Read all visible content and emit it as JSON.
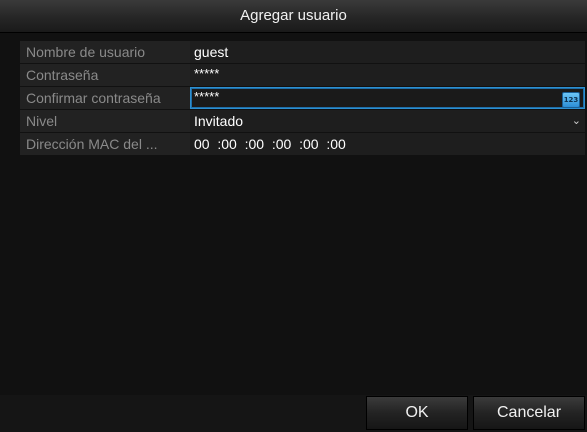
{
  "dialog": {
    "title": "Agregar usuario"
  },
  "form": {
    "username": {
      "label": "Nombre de usuario",
      "value": "guest"
    },
    "password": {
      "label": "Contraseña",
      "value": "*****"
    },
    "confirm_password": {
      "label": "Confirmar contraseña",
      "value": "*****",
      "keyboard_icon_text": "123"
    },
    "level": {
      "label": "Nivel",
      "value": "Invitado"
    },
    "mac": {
      "label": "Dirección MAC del ...",
      "segments": [
        "00",
        "00",
        "00",
        "00",
        "00",
        "00"
      ]
    }
  },
  "buttons": {
    "ok_label": "OK",
    "cancel_label": "Cancelar"
  },
  "colors": {
    "focus_border": "#2d8fd0",
    "label_text": "#8a8a8a",
    "value_text": "#ffffff"
  }
}
